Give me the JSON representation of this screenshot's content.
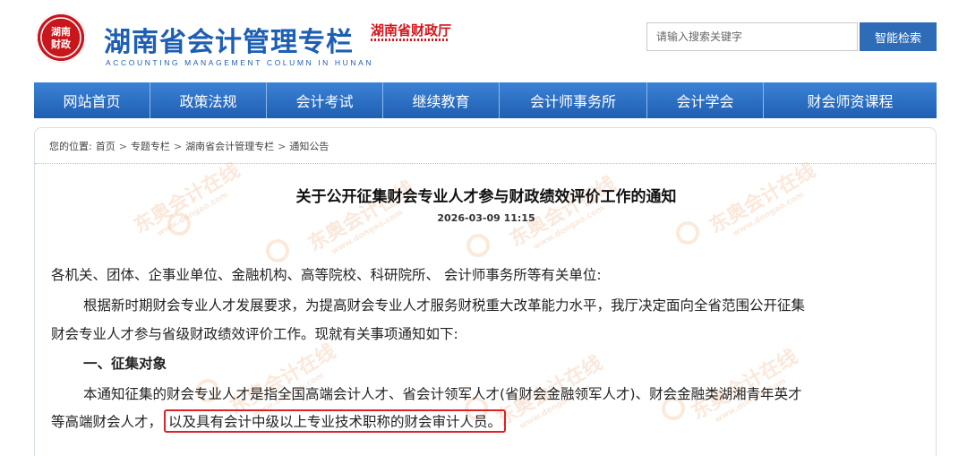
{
  "header": {
    "seal_text": "湖南财政",
    "site_title": "湖南省会计管理专栏",
    "site_subtitle": "ACCOUNTING MANAGEMENT COLUMN IN HUNAN",
    "dept_logo": "湖南省财政厅"
  },
  "search": {
    "placeholder": "请输入搜索关键字",
    "button_label": "智能检索"
  },
  "nav": {
    "items": [
      {
        "label": "网站首页"
      },
      {
        "label": "政策法规"
      },
      {
        "label": "会计考试"
      },
      {
        "label": "继续教育"
      },
      {
        "label": "会计师事务所"
      },
      {
        "label": "会计学会"
      },
      {
        "label": "财会师资课程"
      }
    ]
  },
  "breadcrumb": {
    "prefix": "您的位置:",
    "items": [
      "首页",
      "专题专栏",
      "湖南省会计管理专栏",
      "通知公告"
    ],
    "separator": ">"
  },
  "article": {
    "title": "关于公开征集财会专业人才参与财政绩效评价工作的通知",
    "date": "2026-03-09 11:15",
    "salutation": "各机关、团体、企事业单位、金融机构、高等院校、科研院所、 会计师事务所等有关单位:",
    "para1_line1": "根据新时期财会专业人才发展要求，为提高财会专业人才服务财税重大改革能力水平，我厅决定面向全省范围公开征集",
    "para1_line2": "财会专业人才参与省级财政绩效评价工作。现就有关事项通知如下:",
    "section1_heading": "一、征集对象",
    "para2_line1": "本通知征集的财会专业人才是指全国高端会计人才、省会计领军人才(省财会金融领军人才)、财会金融类湖湘青年英才",
    "para2_line2_prefix": "等高端财会人才，",
    "para2_line2_highlight": "以及具有会计中级以上专业技术职称的财会审计人员。"
  },
  "watermark": {
    "text": "东奥会计在线",
    "url": "www.dongao.com"
  },
  "colors": {
    "brand_blue": "#1d5fb5",
    "nav_blue": "#2f6cb8",
    "seal_red": "#c8161d",
    "highlight_red": "#e01f26"
  }
}
